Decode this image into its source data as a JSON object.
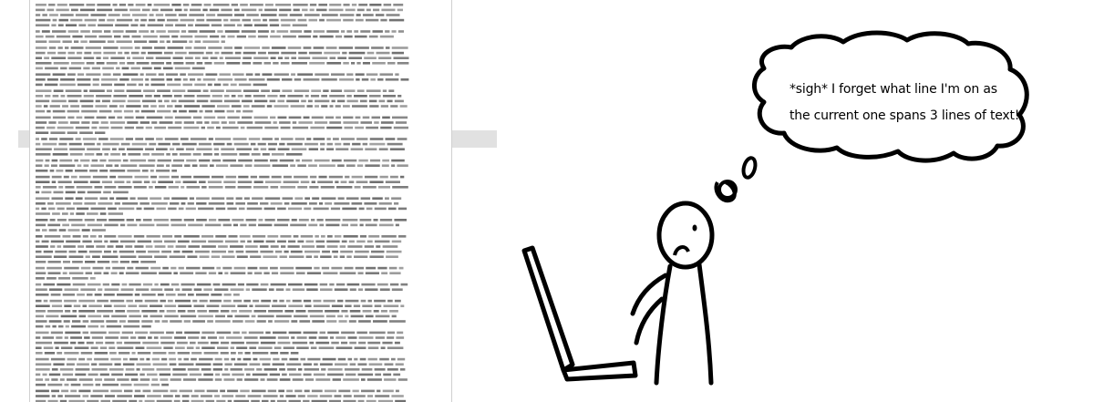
{
  "thought_bubble": {
    "line1": "*sigh* I forget what line I'm on as",
    "line2": "the current one spans 3 lines of text!"
  },
  "colors": {
    "ink": "#000000",
    "doc_text": "#555555",
    "highlight": "#c8c8c8",
    "page_border": "#d0d0d0"
  },
  "document": {
    "highlighted_line_count": 3
  }
}
